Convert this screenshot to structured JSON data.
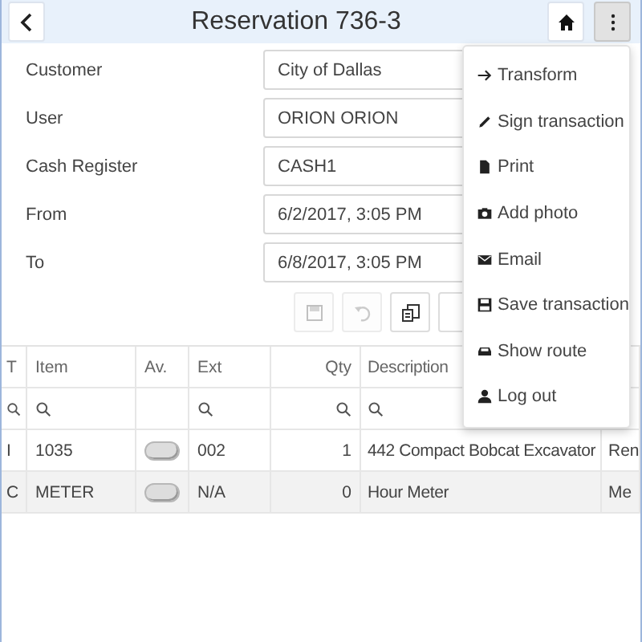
{
  "header": {
    "title": "Reservation 736-3"
  },
  "form": {
    "fields": [
      {
        "label": "Customer",
        "value": "City of Dallas"
      },
      {
        "label": "User",
        "value": "ORION ORION"
      },
      {
        "label": "Cash Register",
        "value": "CASH1"
      },
      {
        "label": "From",
        "value": "6/2/2017, 3:05 PM"
      },
      {
        "label": "To",
        "value": "6/8/2017, 3:05 PM"
      }
    ]
  },
  "toolbar": [
    {
      "kind": "save",
      "disabled": true
    },
    {
      "kind": "undo",
      "disabled": true
    },
    {
      "kind": "copy",
      "disabled": false
    },
    {
      "kind": "blank",
      "disabled": false
    }
  ],
  "menu": {
    "items": [
      {
        "kind": "arrow",
        "label": "Transform"
      },
      {
        "kind": "pencil",
        "label": "Sign transaction"
      },
      {
        "kind": "file",
        "label": "Print"
      },
      {
        "kind": "camera",
        "label": "Add photo"
      },
      {
        "kind": "mail",
        "label": "Email"
      },
      {
        "kind": "floppy",
        "label": "Save transaction"
      },
      {
        "kind": "car",
        "label": "Show route"
      },
      {
        "kind": "user",
        "label": "Log out"
      }
    ]
  },
  "table": {
    "columns": [
      {
        "label": "T",
        "filter": true
      },
      {
        "label": "Item",
        "filter": true
      },
      {
        "label": "Av.",
        "filter": false
      },
      {
        "label": "Ext",
        "filter": true
      },
      {
        "label": "Qty",
        "filter": true
      },
      {
        "label": "Description",
        "filter": true
      },
      {
        "filter": false
      }
    ],
    "rows": [
      {
        "cells": [
          "I",
          "1035",
          {
            "kind": "toggle",
            "on": false
          },
          "002",
          "1",
          "442 Compact Bobcat Excavator",
          "Ren"
        ]
      },
      {
        "cells": [
          "C",
          "METER",
          {
            "kind": "toggle",
            "on": false
          },
          "N/A",
          "0",
          "Hour Meter",
          "Me"
        ]
      }
    ]
  }
}
